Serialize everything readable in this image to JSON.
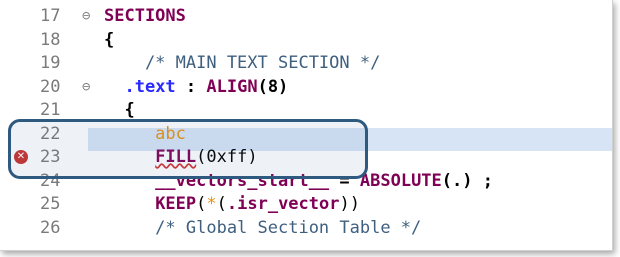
{
  "editor": {
    "lines": [
      {
        "num": "17",
        "fold": "⊖",
        "parts": [
          {
            "t": "SECTIONS",
            "c": "kw"
          }
        ]
      },
      {
        "num": "18",
        "fold": "",
        "parts": [
          {
            "t": "{",
            "c": "bold"
          }
        ]
      },
      {
        "num": "19",
        "fold": "",
        "parts": [
          {
            "t": "    /* MAIN TEXT SECTION */",
            "c": "cm"
          }
        ]
      },
      {
        "num": "20",
        "fold": "⊖",
        "parts": [
          {
            "t": "  ",
            "c": ""
          },
          {
            "t": ".text",
            "c": "sec"
          },
          {
            "t": " : ",
            "c": "bold"
          },
          {
            "t": "ALIGN",
            "c": "kw"
          },
          {
            "t": "(8)",
            "c": "bold"
          }
        ]
      },
      {
        "num": "21",
        "fold": "",
        "parts": [
          {
            "t": "  {",
            "c": "bold"
          }
        ]
      },
      {
        "num": "22",
        "fold": "",
        "parts": [
          {
            "t": "     abc",
            "c": "lbl"
          }
        ]
      },
      {
        "num": "23",
        "fold": "",
        "error": true,
        "parts": [
          {
            "t": "     ",
            "c": ""
          },
          {
            "t": "FILL",
            "c": "kw err"
          },
          {
            "t": "(0xff)",
            "c": ""
          }
        ]
      },
      {
        "num": "24",
        "fold": "",
        "parts": [
          {
            "t": "     __vectors_start__",
            "c": "kw"
          },
          {
            "t": " = ",
            "c": "bold"
          },
          {
            "t": "ABSOLUTE",
            "c": "kw"
          },
          {
            "t": "(.) ;",
            "c": "bold"
          }
        ]
      },
      {
        "num": "25",
        "fold": "",
        "parts": [
          {
            "t": "     ",
            "c": ""
          },
          {
            "t": "KEEP",
            "c": "kw"
          },
          {
            "t": "(",
            "c": ""
          },
          {
            "t": "*",
            "c": "lbl"
          },
          {
            "t": "(",
            "c": ""
          },
          {
            "t": ".isr_vector",
            "c": "kw"
          },
          {
            "t": "))",
            "c": ""
          }
        ]
      },
      {
        "num": "26",
        "fold": "",
        "parts": [
          {
            "t": "     /* Global Section Table */",
            "c": "cm"
          }
        ]
      }
    ],
    "error_marker_symbol": "✕",
    "colors": {
      "keyword": "#7f0055",
      "section": "#2a2aff",
      "comment": "#3f5f7f",
      "label": "#e8920f",
      "selection": "#d6e4f5",
      "highlight_border": "#2f5a80",
      "error": "#c9312c"
    }
  }
}
